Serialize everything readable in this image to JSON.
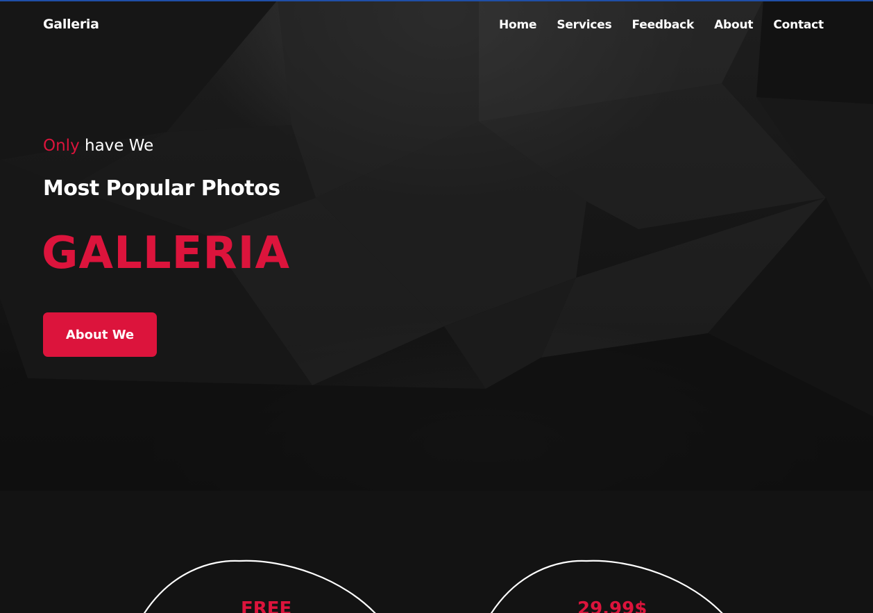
{
  "header": {
    "brand": "Galleria",
    "nav": [
      "Home",
      "Services",
      "Feedback",
      "About",
      "Contact"
    ]
  },
  "hero": {
    "tagline_accent": "Only",
    "tagline_rest": " have We",
    "subtitle": "Most Popular Photos",
    "headline": "GALLERIA",
    "cta_label": "About We"
  },
  "pricing": {
    "plans": [
      {
        "price": "FREE"
      },
      {
        "price": "29.99$"
      }
    ]
  },
  "colors": {
    "accent": "#dc143c",
    "text": "#ffffff",
    "background": "#131313",
    "top_line": "#1f4fa8"
  }
}
